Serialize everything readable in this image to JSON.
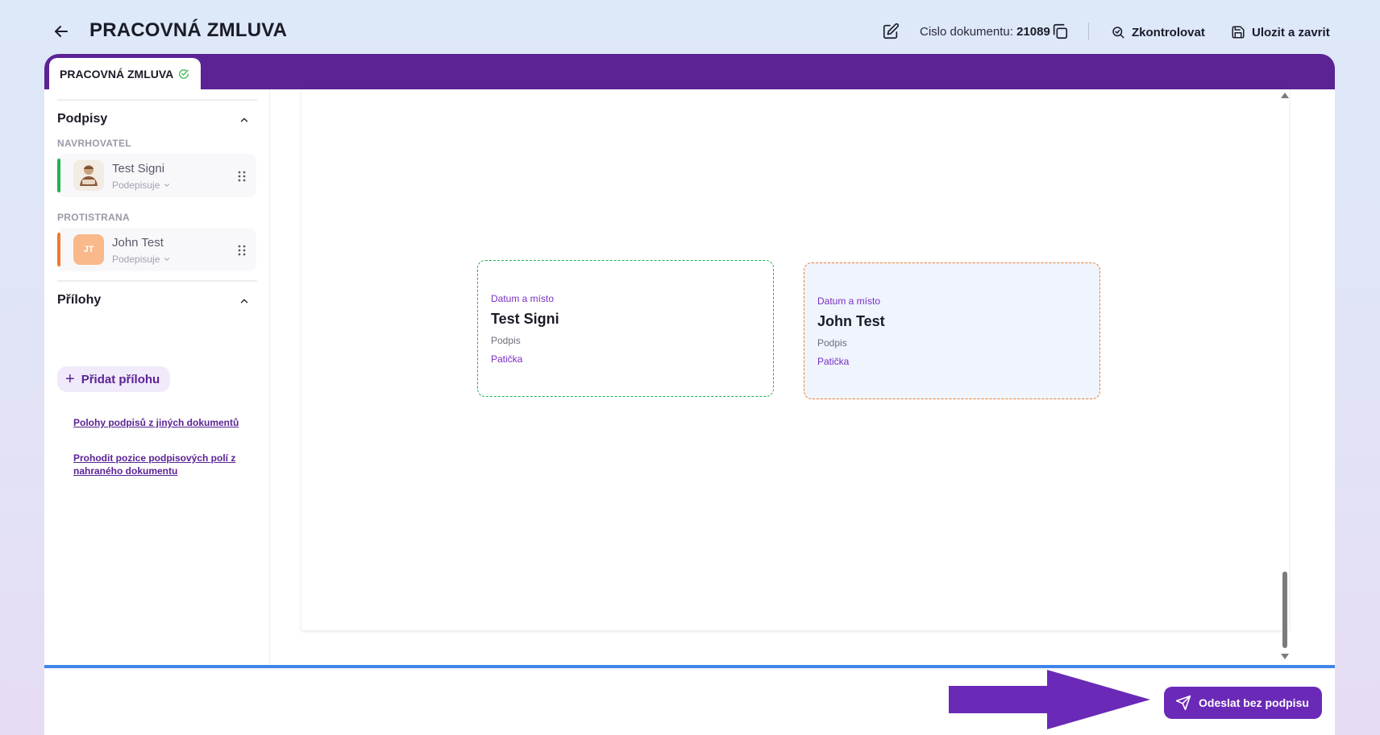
{
  "header": {
    "title": "PRACOVNÁ ZMLUVA",
    "doc_number_label": "Cislo dokumentu:",
    "doc_number": "21089",
    "check_label": "Zkontrolovat",
    "save_close_label": "Ulozit a zavrit"
  },
  "tab": {
    "label": "PRACOVNÁ ZMLUVA"
  },
  "sidebar": {
    "signatures_title": "Podpisy",
    "proposer_label": "NAVRHOVATEL",
    "counterparty_label": "PROTISTRANA",
    "signers": [
      {
        "name": "Test Signi",
        "role": "Podepisuje",
        "initials": "",
        "accent": "#22b14c"
      },
      {
        "name": "John Test",
        "role": "Podepisuje",
        "initials": "JT",
        "accent": "#f07a2a"
      }
    ],
    "attachments_title": "Přílohy",
    "add_attachment_label": "Přidat přílohu",
    "link_positions": "Polohy podpisů z jiných dokumentů",
    "link_swap_line1": "Prohodit pozice podpisových polí z",
    "link_swap_line2": "nahraného dokumentu"
  },
  "signature_fields": [
    {
      "date_place": "Datum a místo",
      "name": "Test Signi",
      "signature": "Podpis",
      "footer": "Patička",
      "border": "#22b14c"
    },
    {
      "date_place": "Datum a místo",
      "name": "John Test",
      "signature": "Podpis",
      "footer": "Patička",
      "border": "#f07a2a"
    }
  ],
  "footer": {
    "send_without_signature_label": "Odeslat bez podpisu"
  },
  "colors": {
    "brand_purple": "#5b2394",
    "button_purple": "#6a2ab7",
    "footer_line": "#3f86e8",
    "proposer_accent": "#22b14c",
    "counterparty_accent": "#f07a2a"
  }
}
